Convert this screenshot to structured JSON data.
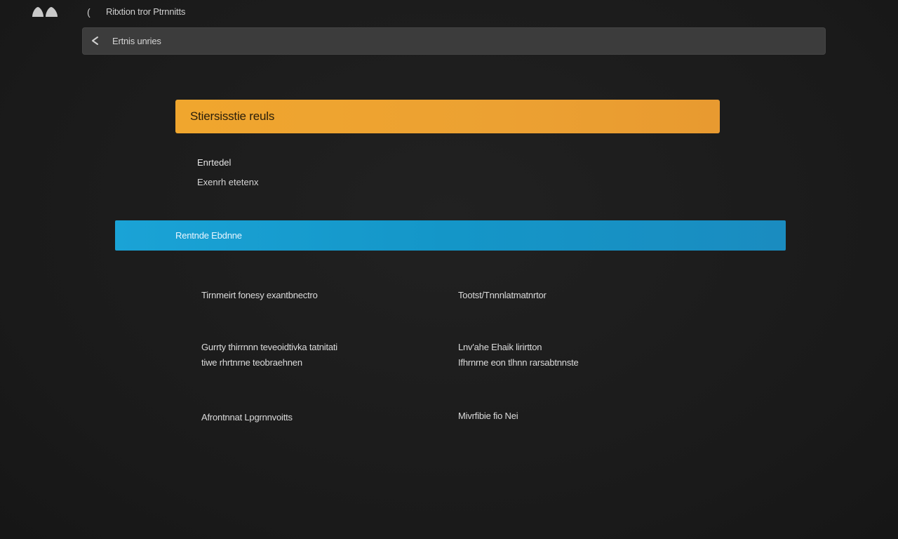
{
  "window": {
    "back_glyph": "(",
    "title": "Ritxtion tror Ptrnnitts"
  },
  "address_bar": {
    "text": "Ertnis unries"
  },
  "orange_banner": {
    "text": "Stiersisstie reuls",
    "color": "#f0a62e"
  },
  "section_labels": {
    "label_1": "Enrtedel",
    "label_2": "Exenrh etetenx"
  },
  "blue_banner": {
    "text": "Rentnde Ebdnne",
    "color": "#1aa3d6"
  },
  "items": {
    "left": [
      {
        "line1": "Tirnmeirt fonesy exantbnectro",
        "line2": ""
      },
      {
        "line1": "Gurrty thirrnnn teveoidtivka tatnitati",
        "line2": "tiwe rhrtnrne teobraehnen"
      },
      {
        "line1": "Afrontnnat Lpgrnnvoitts",
        "line2": ""
      }
    ],
    "right": [
      {
        "line1": "Tootst/Tnnnlatmatnrtor",
        "line2": ""
      },
      {
        "line1": "Lnv'ahe Ehaik lirirtton",
        "line2": "Ifhrnrne eon tlhnn rarsabtnnste"
      },
      {
        "line1": "Mivrfibie fio Nei",
        "line2": ""
      }
    ]
  }
}
